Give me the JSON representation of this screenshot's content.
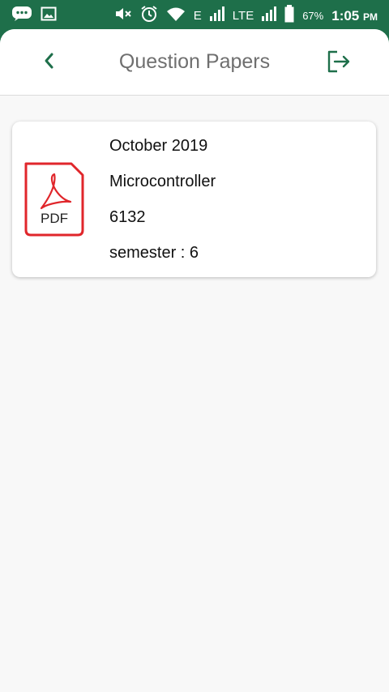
{
  "status_bar": {
    "network_1": "E",
    "network_2": "LTE",
    "battery": "67%",
    "time": "1:05",
    "ampm": "PM",
    "icons": [
      "message-icon",
      "image-icon",
      "mute-icon",
      "alarm-icon",
      "wifi-icon",
      "signal-icon",
      "battery-icon"
    ]
  },
  "header": {
    "title": "Question Papers",
    "back_icon": "chevron-left-icon",
    "logout_icon": "logout-icon"
  },
  "papers": [
    {
      "icon": "pdf-icon",
      "icon_label": "PDF",
      "date": "October 2019",
      "subject": "Microcontroller",
      "code": "6132",
      "semester": "semester : 6"
    }
  ],
  "colors": {
    "status_bar": "#1e6f4a",
    "accent": "#1e6f4a",
    "pdf_red": "#e0262b",
    "background": "#f8f8f8"
  }
}
